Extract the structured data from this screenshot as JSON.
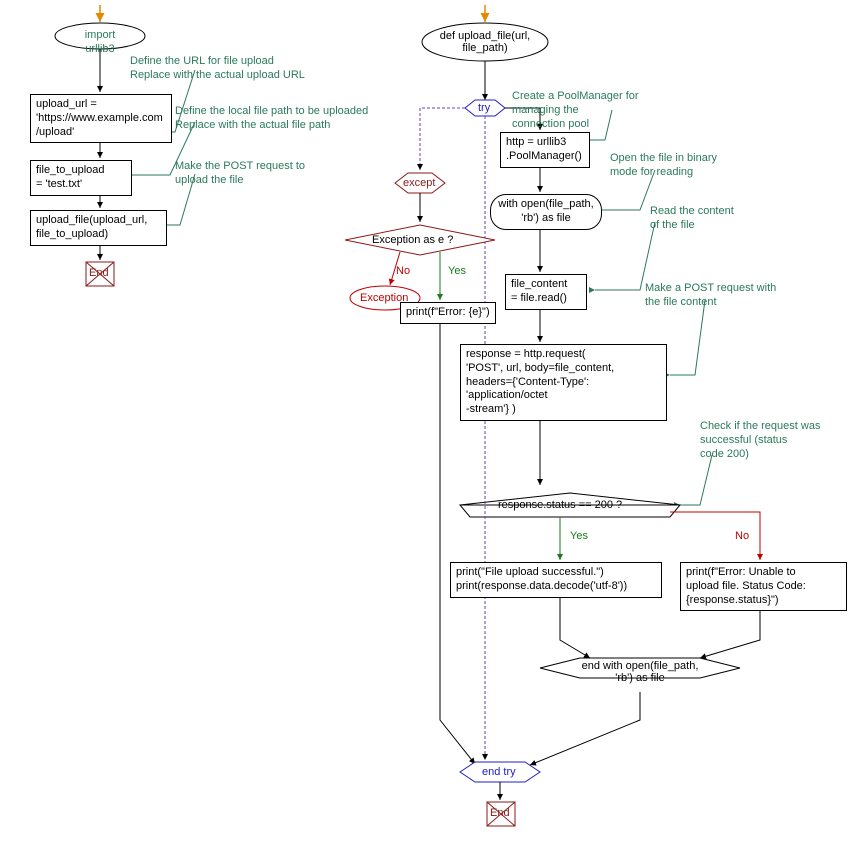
{
  "left": {
    "start_node": "import urllib3",
    "comment1_l1": "Define the URL for file upload",
    "comment1_l2": "Replace with the actual upload URL",
    "box1_l1": "upload_url =",
    "box1_l2": "'https://www.example.com",
    "box1_l3": "/upload'",
    "comment2_l1": "Define the local file path to be uploaded",
    "comment2_l2": "Replace with the actual file path",
    "box2_l1": "file_to_upload",
    "box2_l2": "= 'test.txt'",
    "comment3_l1": "Make the POST request to",
    "comment3_l2": "upload the file",
    "box3_l1": "upload_file(upload_url,",
    "box3_l2": "file_to_upload)",
    "end": "End"
  },
  "right": {
    "def_l1": "def upload_file(url,",
    "def_l2": "file_path)",
    "try": "try",
    "comment_try_l1": "Create a PoolManager for",
    "comment_try_l2": "managing the",
    "comment_try_l3": "connection pool",
    "http_l1": "http = urllib3",
    "http_l2": ".PoolManager()",
    "comment_open_l1": "Open the file in binary",
    "comment_open_l2": "mode for reading",
    "with_l1": "with open(file_path,",
    "with_l2": "'rb') as file",
    "comment_read_l1": "Read the content",
    "comment_read_l2": "of the file",
    "read_l1": "file_content",
    "read_l2": "= file.read()",
    "comment_post_l1": "Make a POST request with",
    "comment_post_l2": "the file content",
    "resp_l1": "response = http.request(",
    "resp_l2": "'POST', url, body=file_content,",
    "resp_l3": "headers={'Content-Type':",
    "resp_l4": "'application/octet",
    "resp_l5": "-stream'} )",
    "comment_check_l1": "Check if the request was",
    "comment_check_l2": "successful (status",
    "comment_check_l3": "code 200)",
    "cond": "response.status == 200 ?",
    "yes": "Yes",
    "no": "No",
    "succ_l1": "print(\"File upload successful.\")",
    "succ_l2": "print(response.data.decode('utf-8'))",
    "err_l1": "print(f\"Error: Unable to",
    "err_l2": "upload file. Status Code:",
    "err_l3": "{response.status}\")",
    "endwith_l1": "end with open(file_path,",
    "endwith_l2": "'rb') as file",
    "except": "except",
    "exc_cond": "Exception as e ?",
    "exception": "Exception",
    "print_err": "print(f\"Error: {e}\")",
    "end_try": "end try",
    "end": "End"
  }
}
